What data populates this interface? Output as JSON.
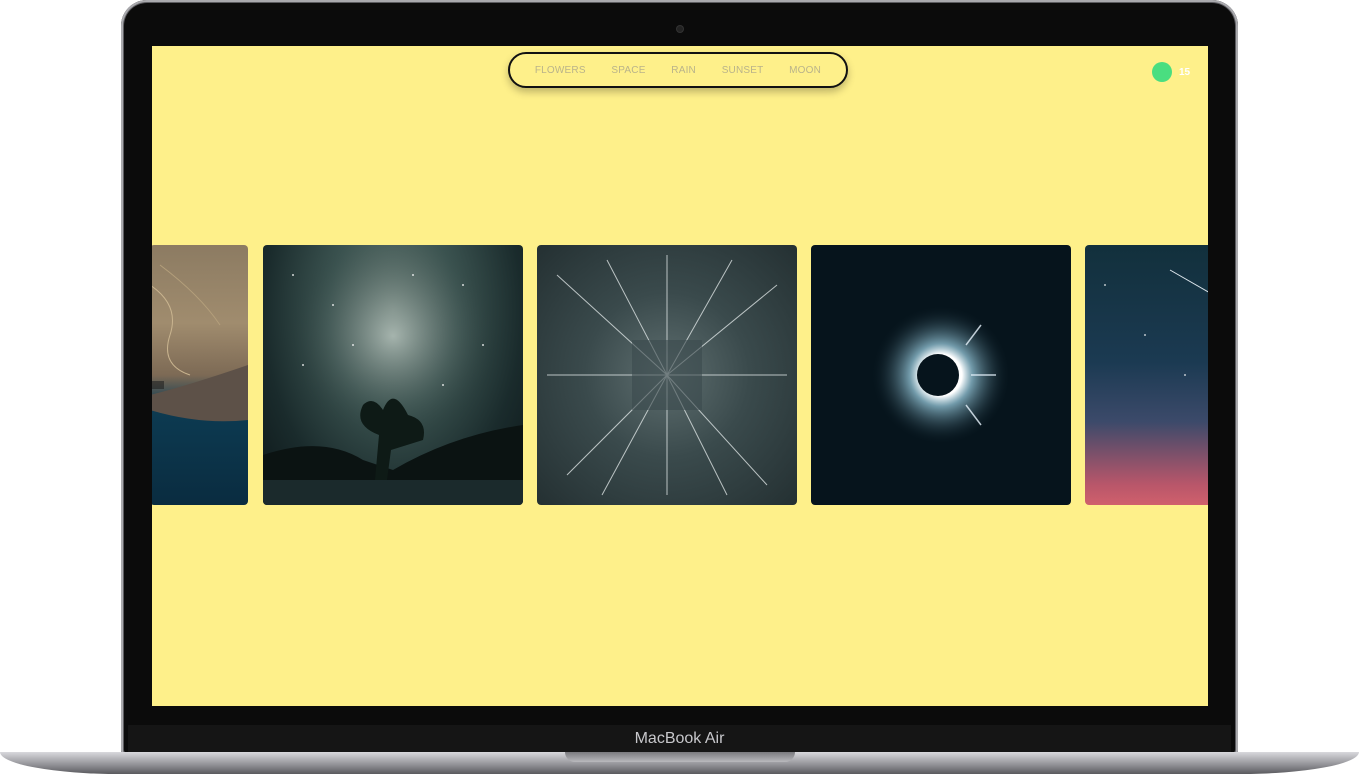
{
  "nav": {
    "items": [
      "FLOWERS",
      "SPACE",
      "RAIN",
      "SUNSET",
      "MOON"
    ]
  },
  "counter": {
    "value": "15",
    "color": "#4ade80"
  },
  "device": {
    "label": "MacBook Air"
  },
  "gallery": {
    "category": "SPACE",
    "items": [
      {
        "icon": "earth-satellite-image"
      },
      {
        "icon": "milky-way-tree-lake-image"
      },
      {
        "icon": "star-trails-image"
      },
      {
        "icon": "solar-eclipse-image"
      },
      {
        "icon": "night-sky-gradient-image"
      }
    ]
  },
  "colors": {
    "background": "#fef08a",
    "accent": "#4ade80"
  }
}
